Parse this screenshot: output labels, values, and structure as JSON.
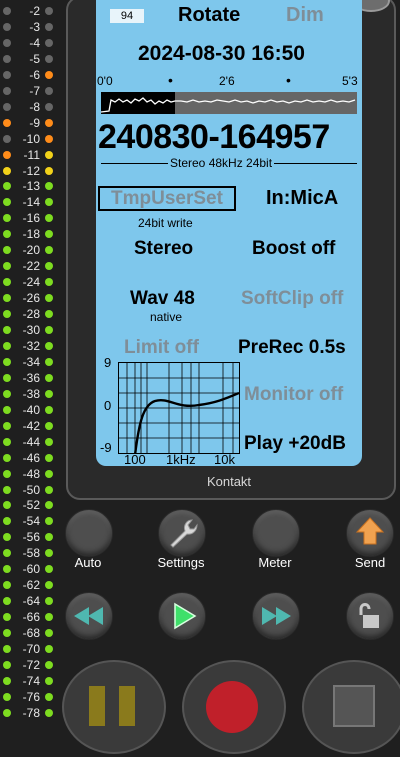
{
  "meter": {
    "labels": [
      "-2",
      "-3",
      "-4",
      "-5",
      "-6",
      "-7",
      "-8",
      "-9",
      "-10",
      "-11",
      "-12",
      "-13",
      "-14",
      "-16",
      "-18",
      "-20",
      "-22",
      "-24",
      "-26",
      "-28",
      "-30",
      "-32",
      "-34",
      "-36",
      "-38",
      "-40",
      "-42",
      "-44",
      "-46",
      "-48",
      "-50",
      "-52",
      "-54",
      "-56",
      "-58",
      "-60",
      "-62",
      "-64",
      "-66",
      "-68",
      "-70",
      "-72",
      "-74",
      "-76",
      "-78"
    ],
    "colors": {
      "off": "#666666",
      "orange": "#ff8c1a",
      "yellow": "#f2d21a",
      "green": "#7edc20"
    }
  },
  "screen": {
    "badge": "94",
    "rotate": "Rotate",
    "dim": "Dim",
    "datetime": "2024-08-30  16:50",
    "timeline": {
      "start": "0'0",
      "mid": "2'6",
      "end": "5'3"
    },
    "progress_fraction": 0.29,
    "filename": "240830-164957",
    "format": "Stereo 48kHz 24bit",
    "preset": "TmpUserSet",
    "preset_sub": "24bit write",
    "input": "In:MicA",
    "channels": "Stereo",
    "boost": "Boost off",
    "file_type": "Wav 48",
    "file_type_sub": "native",
    "softclip": "SoftClip off",
    "limit": "Limit off",
    "prerec": "PreRec 0.5s",
    "monitor": "Monitor off",
    "play": "Play +20dB",
    "eq": {
      "y_labels": [
        "9",
        "0",
        "-9"
      ],
      "x_labels": [
        "100",
        "1kHz",
        "10k"
      ]
    }
  },
  "device_label": "Kontakt",
  "buttons": {
    "auto": "Auto",
    "settings": "Settings",
    "meter": "Meter",
    "send": "Send"
  }
}
